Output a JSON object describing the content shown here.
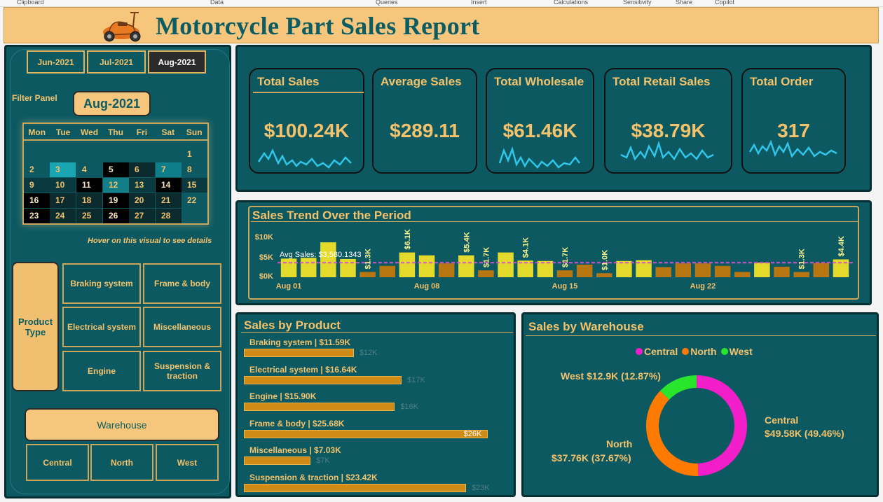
{
  "ribbon": [
    "Clipboard",
    "Data",
    "Queries",
    "Insert",
    "Calculations",
    "Sensitivity",
    "Share",
    "Copilot"
  ],
  "header": {
    "title": "Motorcycle Part Sales Report"
  },
  "filter": {
    "months": [
      "Jun-2021",
      "Jul-2021",
      "Aug-2021"
    ],
    "selected_month": "Aug-2021",
    "panel_label": "Filter Panel",
    "calendar_days": [
      "Mon",
      "Tue",
      "Wed",
      "Thu",
      "Fri",
      "Sat",
      "Sun"
    ],
    "hover_hint": "Hover on this visual to see details"
  },
  "product_type": {
    "label": "Product Type",
    "options": [
      "Braking system",
      "Frame & body",
      "Electrical system",
      "Miscellaneous",
      "Engine",
      "Suspension & traction"
    ]
  },
  "warehouse": {
    "label": "Warehouse",
    "options": [
      "Central",
      "North",
      "West"
    ]
  },
  "kpis": [
    {
      "title": "Total Sales",
      "value": "$100.24K"
    },
    {
      "title": "Average Sales",
      "value": "$289.11"
    },
    {
      "title": "Total Wholesale",
      "value": "$61.46K"
    },
    {
      "title": "Total Retail Sales",
      "value": "$38.79K"
    },
    {
      "title": "Total Order",
      "value": "317"
    }
  ],
  "trend": {
    "title": "Sales Trend Over the Period",
    "avg_label": "Avg Sales: $3,580.1343",
    "y_ticks": [
      "$0K",
      "$5K",
      "$10K"
    ],
    "x_ticks": [
      "Aug 01",
      "Aug 08",
      "Aug 15",
      "Aug 22"
    ],
    "bar_labels": [
      "$1.3K",
      "$5.4K",
      "$6.1K",
      "$1.7K",
      "$4.1K",
      "$1.7K",
      "$1.0K",
      "$1.3K",
      "$4.4K"
    ]
  },
  "chart_data": [
    {
      "type": "bar",
      "title": "Sales Trend Over the Period",
      "categories": [
        "Aug 01",
        "Aug 02",
        "Aug 03",
        "Aug 04",
        "Aug 05",
        "Aug 06",
        "Aug 07",
        "Aug 08",
        "Aug 09",
        "Aug 10",
        "Aug 11",
        "Aug 12",
        "Aug 13",
        "Aug 14",
        "Aug 15",
        "Aug 16",
        "Aug 17",
        "Aug 18",
        "Aug 19",
        "Aug 20",
        "Aug 21",
        "Aug 22",
        "Aug 23",
        "Aug 24",
        "Aug 25",
        "Aug 26",
        "Aug 27",
        "Aug 28",
        "Aug 29"
      ],
      "values": [
        4.6,
        4.8,
        8.6,
        4.5,
        1.3,
        2.8,
        6.1,
        5.4,
        3.4,
        5.4,
        1.7,
        6.1,
        4.1,
        4.0,
        1.7,
        3.1,
        1.0,
        4.0,
        4.2,
        2.5,
        3.4,
        3.4,
        2.8,
        1.3,
        3.6,
        2.6,
        1.3,
        3.5,
        4.4
      ],
      "bar_colors": [
        "#e4da2c",
        "#e4da2c",
        "#e4da2c",
        "#e4da2c",
        "#b87612",
        "#b87612",
        "#e4da2c",
        "#e4da2c",
        "#b87612",
        "#e4da2c",
        "#b87612",
        "#e4da2c",
        "#e4da2c",
        "#e4da2c",
        "#b87612",
        "#b87612",
        "#b87612",
        "#e4da2c",
        "#e4da2c",
        "#b87612",
        "#b87612",
        "#b87612",
        "#b87612",
        "#b87612",
        "#e4da2c",
        "#b87612",
        "#b87612",
        "#b87612",
        "#e4da2c"
      ],
      "ylim": [
        0,
        10
      ],
      "y_ticks": [
        0,
        5,
        10
      ],
      "reference_line": {
        "label": "Avg Sales",
        "value": 3.58
      },
      "unit": "$K"
    },
    {
      "type": "bar",
      "title": "Sales by Product",
      "categories": [
        "Braking system",
        "Electrical system",
        "Engine",
        "Frame & body",
        "Miscellaneous",
        "Suspension & traction"
      ],
      "values": [
        11.59,
        16.64,
        15.9,
        25.68,
        7.03,
        23.42
      ],
      "labels": [
        "Braking system | $11.59K",
        "Electrical system | $16.64K",
        "Engine | $15.90K",
        "Frame & body | $25.68K",
        "Miscellaneous | $7.03K",
        "Suspension & traction | $23.42K"
      ],
      "value_labels": [
        "$12K",
        "$17K",
        "$16K",
        "$26K",
        "$7K",
        "$23K"
      ],
      "xlim": [
        0,
        26
      ]
    },
    {
      "type": "pie",
      "title": "Sales by Warehouse",
      "categories": [
        "Central",
        "North",
        "West"
      ],
      "values": [
        49.46,
        37.67,
        12.87
      ],
      "colors": [
        "#f21ec9",
        "#ff7a00",
        "#29e52c"
      ],
      "labels": [
        "Central",
        "$49.58K (49.46%)",
        "North",
        "$37.76K (37.67%)",
        "West $12.9K (12.87%)"
      ],
      "legend": "top"
    }
  ],
  "product_chart": {
    "title": "Sales by Product"
  },
  "warehouse_chart": {
    "title": "Sales by Warehouse"
  }
}
